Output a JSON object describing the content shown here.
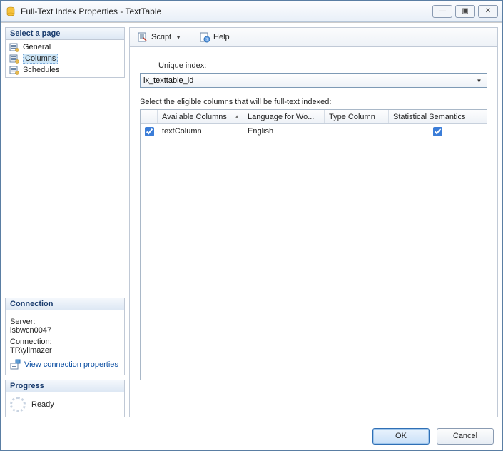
{
  "window": {
    "title": "Full-Text Index Properties - TextTable"
  },
  "titlebar_buttons": {
    "min": "—",
    "max": "▣",
    "close": "✕"
  },
  "sidebar": {
    "select_page_hdr": "Select a page",
    "items": [
      {
        "label": "General"
      },
      {
        "label": "Columns"
      },
      {
        "label": "Schedules"
      }
    ]
  },
  "connection": {
    "hdr": "Connection",
    "server_lbl": "Server:",
    "server_val": "isbwcn0047",
    "conn_lbl": "Connection:",
    "conn_val": "TR\\yilmazer",
    "link": "View connection properties"
  },
  "progress": {
    "hdr": "Progress",
    "status": "Ready"
  },
  "toolbar": {
    "script": "Script",
    "help": "Help"
  },
  "form": {
    "unique_prefix": "U",
    "unique_rest": "nique index:",
    "unique_value": "ix_texttable_id",
    "grid_label": "Select the eligible columns that will be full-text indexed:",
    "headers": {
      "c1": "Available Columns",
      "c2": "Language for Wo...",
      "c3": "Type Column",
      "c4": "Statistical Semantics"
    },
    "rows": [
      {
        "checked": true,
        "name": "textColumn",
        "lang": "English",
        "type": "",
        "stats": true
      }
    ]
  },
  "footer": {
    "ok": "OK",
    "cancel": "Cancel"
  }
}
